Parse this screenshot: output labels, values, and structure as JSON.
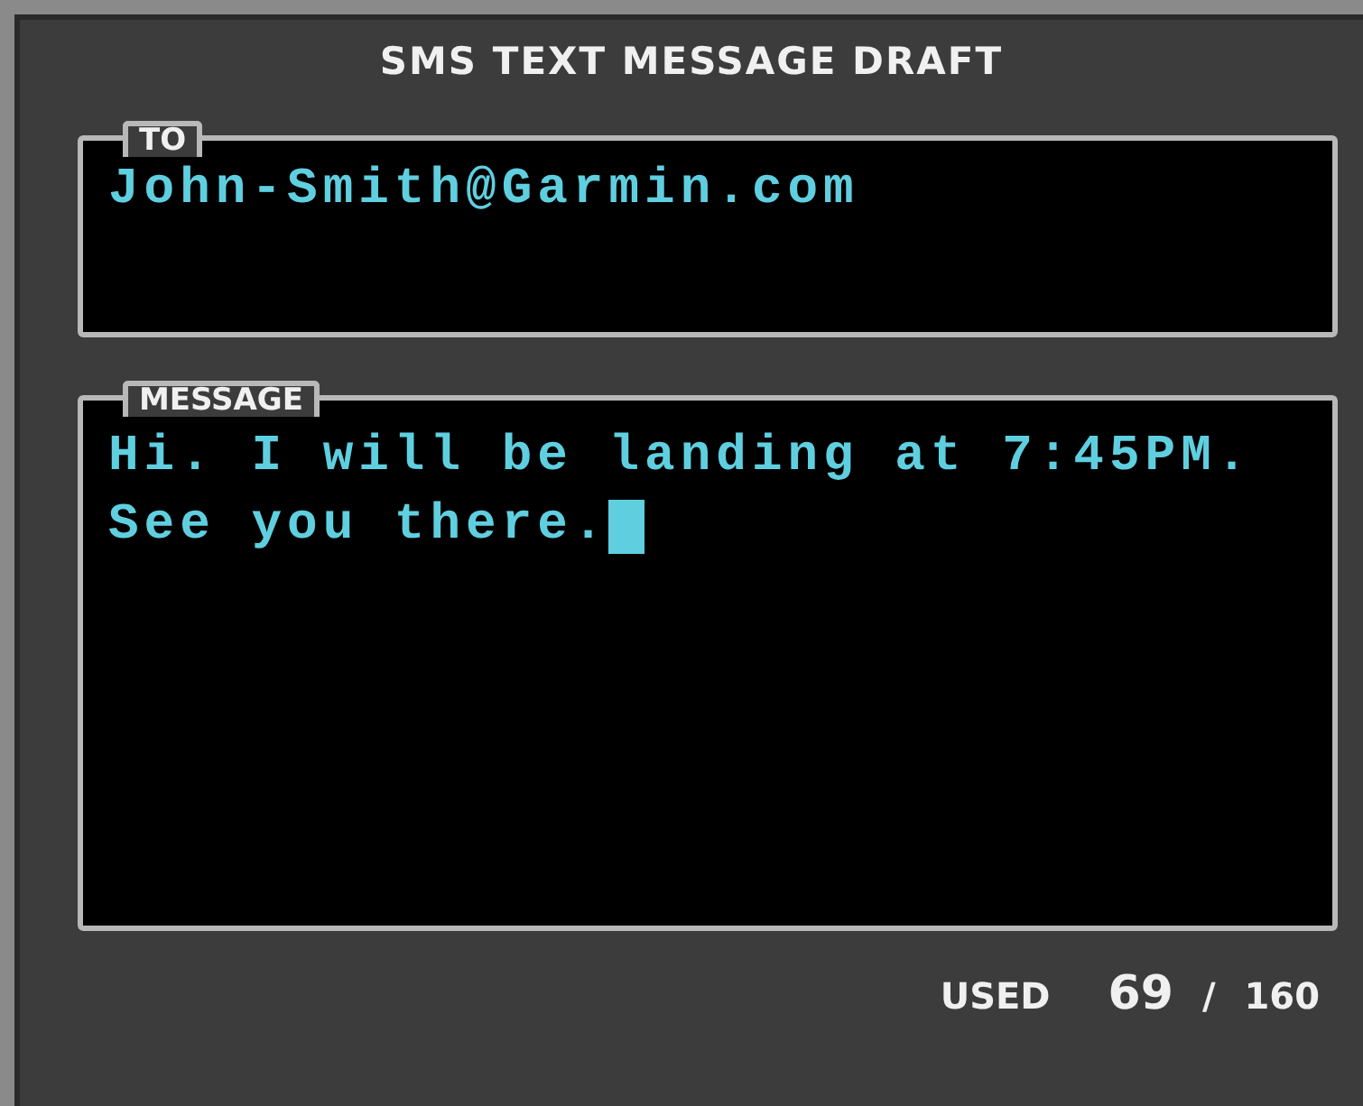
{
  "window": {
    "title": "SMS TEXT MESSAGE DRAFT"
  },
  "to": {
    "label": "TO",
    "value": "John-Smith@Garmin.com"
  },
  "message": {
    "label": "MESSAGE",
    "lines": [
      "Hi. I will be landing at 7:45PM.",
      "See you there."
    ],
    "cursor": true
  },
  "footer": {
    "label": "USED",
    "count": "69",
    "separator": "/",
    "limit": "160"
  }
}
